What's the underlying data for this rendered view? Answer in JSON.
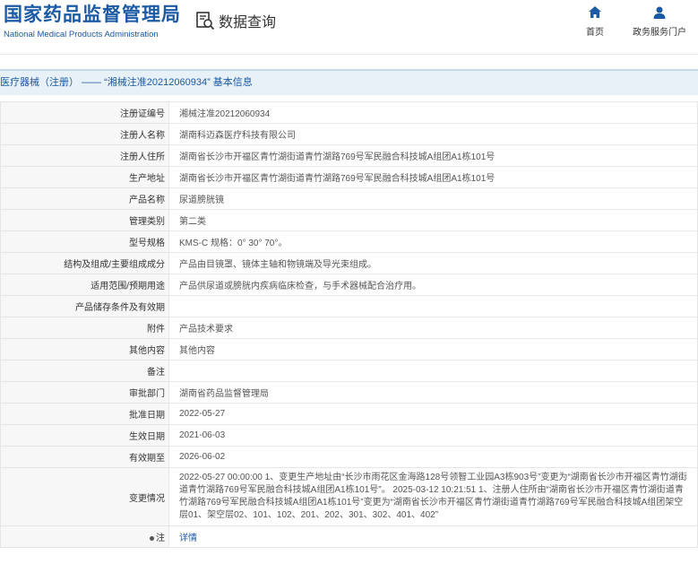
{
  "header": {
    "logo_cn": "国家药品监督管理局",
    "logo_en": "National Medical Products Administration",
    "query_label": "数据查询",
    "nav_home": "首页",
    "nav_services": "政务服务门户",
    "brand_color": "#1b5aa5"
  },
  "breadcrumb": "医疗器械（注册） —— “湘械注准20212060934” 基本信息",
  "rows": [
    {
      "label": "注册证编号",
      "value": "湘械注准20212060934"
    },
    {
      "label": "注册人名称",
      "value": "湖南科迈森医疗科技有限公司"
    },
    {
      "label": "注册人住所",
      "value": "湖南省长沙市开福区青竹湖街道青竹湖路769号军民融合科技城A组团A1栋101号"
    },
    {
      "label": "生产地址",
      "value": "湖南省长沙市开福区青竹湖街道青竹湖路769号军民融合科技城A组团A1栋101号"
    },
    {
      "label": "产品名称",
      "value": "尿道膀胱镜"
    },
    {
      "label": "管理类别",
      "value": "第二类"
    },
    {
      "label": "型号规格",
      "value": "KMS-C 规格：0° 30° 70°。"
    },
    {
      "label": "结构及组成/主要组成成分",
      "value": "产品由目镜罩、镜体主轴和物镜端及导光束组成。"
    },
    {
      "label": "适用范围/预期用途",
      "value": "产品供尿道或膀胱内疾病临床检查，与手术器械配合治疗用。"
    },
    {
      "label": "产品储存条件及有效期",
      "value": ""
    },
    {
      "label": "附件",
      "value": "产品技术要求"
    },
    {
      "label": "其他内容",
      "value": "其他内容"
    },
    {
      "label": "备注",
      "value": ""
    },
    {
      "label": "审批部门",
      "value": "湖南省药品监督管理局"
    },
    {
      "label": "批准日期",
      "value": "2022-05-27"
    },
    {
      "label": "生效日期",
      "value": "2021-06-03"
    },
    {
      "label": "有效期至",
      "value": "2026-06-02"
    }
  ],
  "change": {
    "label": "变更情况",
    "value": "2022-05-27 00:00:00 1、变更生产地址由“长沙市雨花区金海路128号领智工业园A3栋903号”变更为“湖南省长沙市开福区青竹湖街道青竹湖路769号军民融合科技城A组团A1栋101号”。 2025-03-12 10:21:51 1、注册人住所由“湖南省长沙市开福区青竹湖街道青竹湖路769号军民融合科技城A组团A1栋101号”变更为“湖南省长沙市开福区青竹湖街道青竹湖路769号军民融合科技城A组团架空层01、架空层02、101、102、201、202、301、302、401、402”"
  },
  "note": {
    "label": "注",
    "link": "详情"
  }
}
